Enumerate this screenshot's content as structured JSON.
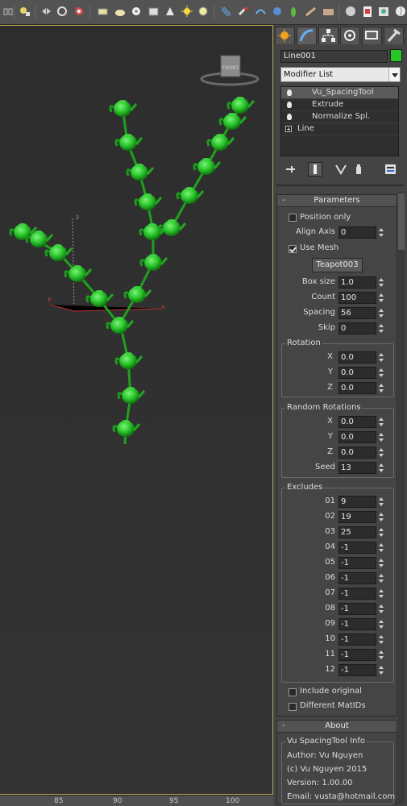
{
  "toolbar": {
    "icons": [
      "link-icon",
      "bind-space-warp-icon",
      "mirror-icon",
      "align-icon",
      "layer-manager-icon",
      "graphite-tools-icon",
      "curve-editor-icon",
      "schematic-view-icon",
      "material-editor-icon",
      "render-setup-icon",
      "render-frame-icon",
      "render-icon",
      "box-icon",
      "sphere-icon",
      "cylinder-icon",
      "cone-icon",
      "light-icon",
      "camera-icon",
      "helper-icon",
      "particle-icon",
      "systems-icon",
      "reactor-icon",
      "geosphere-icon",
      "teapot-icon",
      "maxscript-icon"
    ]
  },
  "viewport": {
    "view_label": "FRONT",
    "axis_labels": {
      "x": "x",
      "y": "y",
      "z": "z"
    }
  },
  "timeline": {
    "ticks": [
      "85",
      "90",
      "95",
      "100"
    ]
  },
  "command_panel": {
    "tabs": [
      "create-tab",
      "modify-tab",
      "hierarchy-tab",
      "motion-tab",
      "display-tab",
      "utilities-tab"
    ],
    "object_name": "Line001",
    "object_color": "#28c628",
    "modifier_list_label": "Modifier List",
    "stack": [
      {
        "label": "Vu_SpacingTool",
        "selected": true,
        "icon": "bulb"
      },
      {
        "label": "Extrude",
        "selected": false,
        "icon": "bulb"
      },
      {
        "label": "Normalize Spl.",
        "selected": false,
        "icon": "bulb"
      },
      {
        "label": "Line",
        "selected": false,
        "icon": "plus"
      }
    ]
  },
  "parameters": {
    "title": "Parameters",
    "position_only_label": "Position only",
    "position_only_checked": false,
    "align_axis_label": "Align Axis",
    "align_axis_value": "0",
    "use_mesh_label": "Use Mesh",
    "use_mesh_checked": true,
    "mesh_button": "Teapot003",
    "box_size_label": "Box size",
    "box_size_value": "1.0",
    "count_label": "Count",
    "count_value": "100",
    "spacing_label": "Spacing",
    "spacing_value": "56",
    "skip_label": "Skip",
    "skip_value": "0",
    "rotation": {
      "title": "Rotation",
      "x_label": "X",
      "x": "0.0",
      "y_label": "Y",
      "y": "0.0",
      "z_label": "Z",
      "z": "0.0"
    },
    "random_rotations": {
      "title": "Random Rotations",
      "x_label": "X",
      "x": "0.0",
      "y_label": "Y",
      "y": "0.0",
      "z_label": "Z",
      "z": "0.0",
      "seed_label": "Seed",
      "seed": "13"
    },
    "excludes": {
      "title": "Excludes",
      "items": [
        {
          "label": "01",
          "value": "9"
        },
        {
          "label": "02",
          "value": "19"
        },
        {
          "label": "03",
          "value": "25"
        },
        {
          "label": "04",
          "value": "-1"
        },
        {
          "label": "05",
          "value": "-1"
        },
        {
          "label": "06",
          "value": "-1"
        },
        {
          "label": "07",
          "value": "-1"
        },
        {
          "label": "08",
          "value": "-1"
        },
        {
          "label": "09",
          "value": "-1"
        },
        {
          "label": "10",
          "value": "-1"
        },
        {
          "label": "11",
          "value": "-1"
        },
        {
          "label": "12",
          "value": "-1"
        }
      ]
    },
    "include_original_label": "Include original",
    "include_original_checked": false,
    "different_matids_label": "Different MatIDs",
    "different_matids_checked": false
  },
  "about": {
    "title": "About",
    "group_title": "Vu SpacingTool Info",
    "author": "Author: Vu Nguyen",
    "copyright": "(c) Vu Nguyen 2015",
    "version": "Version: 1.00.00",
    "email": "Email: vusta@hotmail.com"
  }
}
